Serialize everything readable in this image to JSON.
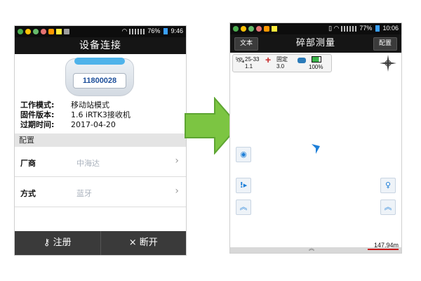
{
  "left_screen": {
    "status_bar": {
      "battery": "76%",
      "time": "9:46",
      "indicators": [
        "app-icon",
        "app-icon",
        "app-icon",
        "app-icon",
        "app-icon",
        "warning-icon",
        "usb-icon",
        "wifi-icon",
        "signal-icon",
        "signal-icon",
        "battery-icon"
      ]
    },
    "title": "设备连接",
    "device": {
      "serial": "11800028"
    },
    "info": [
      {
        "label": "工作模式:",
        "value": "移动站模式"
      },
      {
        "label": "固件版本:",
        "value": "1.6 iRTK3接收机"
      },
      {
        "label": "过期时间:",
        "value": "2017-04-20"
      }
    ],
    "config_section": "配置",
    "config_items": [
      {
        "label": "厂商",
        "value": "中海达"
      },
      {
        "label": "方式",
        "value": "蓝牙"
      }
    ],
    "bottom_buttons": [
      {
        "icon": "key-icon",
        "label": "注册"
      },
      {
        "icon": "close-icon",
        "label": "断开"
      }
    ]
  },
  "right_screen": {
    "status_bar": {
      "battery": "77%",
      "time": "10:06"
    },
    "title": "碎部测量",
    "left_button": "文本",
    "right_button": "配置",
    "status": {
      "satellites": "25-33",
      "satellite_sub": "1.1",
      "fix": "固定",
      "fix_sub": "3.0",
      "battery": "100%"
    },
    "scale": "147.94m",
    "colors": {
      "accent": "#1e7fd8",
      "scale": "#c91a1a",
      "arrow": "#7cc542"
    }
  }
}
